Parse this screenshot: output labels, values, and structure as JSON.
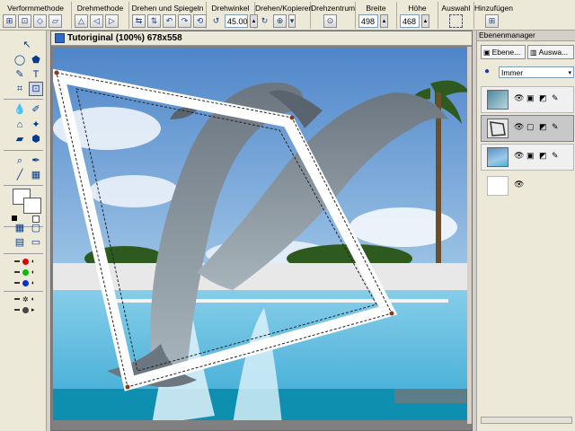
{
  "toolbar": {
    "groups": [
      {
        "label": "Verformmethode"
      },
      {
        "label": "Drehmethode"
      },
      {
        "label": "Drehen und Spiegeln"
      },
      {
        "label": "Drehwinkel",
        "value": "45.00"
      },
      {
        "label": "Drehen/Kopieren"
      },
      {
        "label": "Drehzentrum"
      },
      {
        "label": "Breite",
        "value": "498"
      },
      {
        "label": "Höhe",
        "value": "468"
      },
      {
        "label": "Auswahl"
      },
      {
        "label": "Hinzufügen"
      }
    ]
  },
  "document": {
    "title": "Tutoriginal (100%) 678x558"
  },
  "layer_manager": {
    "title": "Ebenenmanager",
    "tab_layers": "Ebene...",
    "tab_selection": "Auswa...",
    "blend_mode": "Immer",
    "layers": [
      {
        "thumbnail": "dolphin-photo-small",
        "selected": false
      },
      {
        "thumbnail": "frame-outline",
        "selected": true
      },
      {
        "thumbnail": "dolphin-photo",
        "selected": false
      },
      {
        "thumbnail": "blank-white",
        "selected": false
      }
    ]
  },
  "colors": {
    "toolbar_bg": "#ece9d8",
    "selection_bg": "#c8c8c8",
    "accent": "#3169c6"
  }
}
